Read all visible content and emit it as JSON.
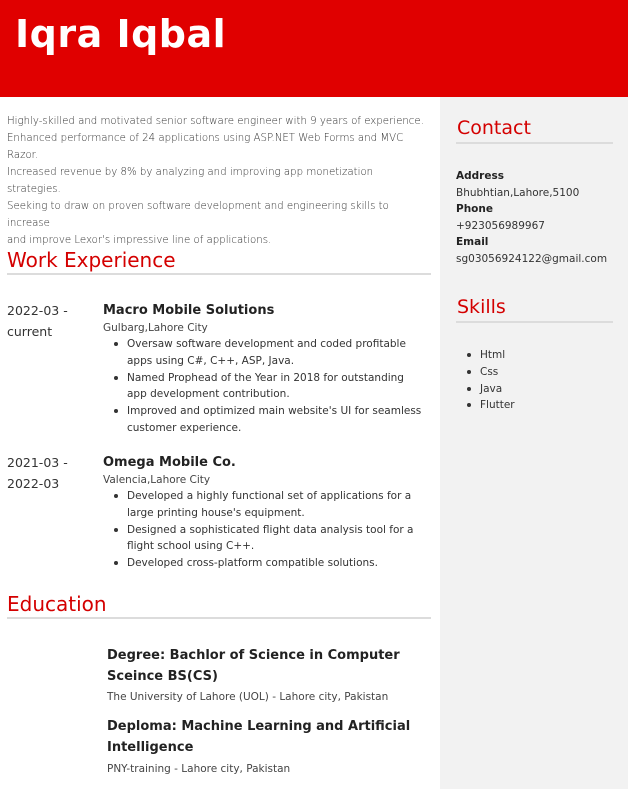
{
  "header": {
    "name": "Iqra Iqbal"
  },
  "summary": [
    "Highly-skilled and motivated senior software engineer with 9 years of experience.",
    "Enhanced performance of 24 applications using ASP.NET Web Forms and MVC Razor.",
    "Increased revenue by 8% by analyzing and improving app monetization strategies.",
    "Seeking to draw on proven software development and engineering skills to increase",
    "and improve Lexor's impressive line of applications."
  ],
  "work": {
    "title": "Work Experience",
    "jobs": [
      {
        "date_start": "2022-03 -",
        "date_end": "current",
        "company": "Macro Mobile Solutions",
        "location": "Gulbarg,Lahore City",
        "bullets": [
          "Oversaw software development and coded profitable apps using C#, C++, ASP, Java.",
          "Named Prophead of the Year in 2018 for outstanding app development contribution.",
          "Improved and optimized main website's UI for seamless customer experience."
        ]
      },
      {
        "date_start": "2021-03 -",
        "date_end": "2022-03",
        "company": "Omega Mobile Co.",
        "location": "Valencia,Lahore City",
        "bullets": [
          "Developed a highly functional set of applications for a large printing house's equipment.",
          "Designed a sophisticated flight data analysis tool for a flight school using C++.",
          "Developed cross-platform compatible solutions."
        ]
      }
    ]
  },
  "education": {
    "title": "Education",
    "items": [
      {
        "degree": "Degree: Bachlor of Science in Computer Sceince BS(CS)",
        "school": "The University of Lahore (UOL) - Lahore city, Pakistan"
      },
      {
        "degree": "Deploma: Machine Learning and Artificial Intelligence",
        "school": "PNY-training - Lahore city, Pakistan"
      }
    ]
  },
  "contact": {
    "title": "Contact",
    "address_label": "Address",
    "address": "Bhubhtian,Lahore,5100",
    "phone_label": "Phone",
    "phone": "+923056989967",
    "email_label": "Email",
    "email": "sg03056924122@gmail.com"
  },
  "skills": {
    "title": "Skills",
    "items": [
      "Html",
      "Css",
      "Java",
      "Flutter"
    ]
  },
  "colors": {
    "accent": "#e00000",
    "heading": "#d40000",
    "sidebar_bg": "#f2f2f2"
  }
}
